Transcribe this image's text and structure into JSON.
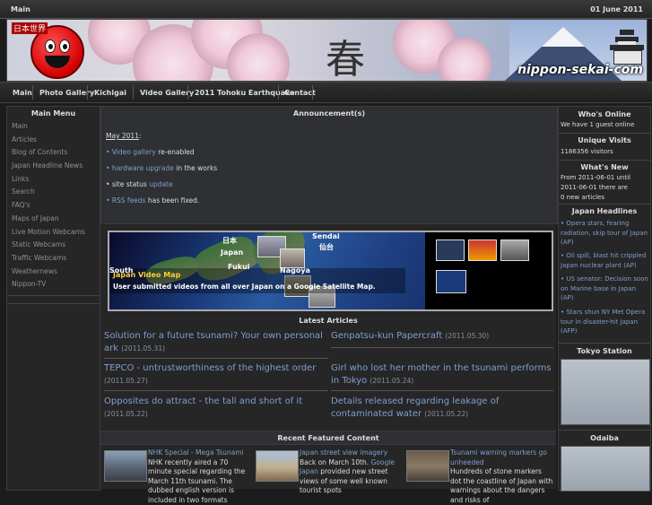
{
  "topbar": {
    "left": "Main",
    "right": "01 June 2011"
  },
  "banner": {
    "logo_text": "日本世界",
    "kanji": "春",
    "site": "nippon-sekai-com"
  },
  "nav": [
    "Main",
    "Photo Gallery",
    "Kichigai",
    "Video Gallery",
    "2011 Tohoku Earthquake",
    "Contact"
  ],
  "left_menu": {
    "title": "Main Menu",
    "items": [
      "Main",
      "Articles",
      "Blog of Contents",
      "Japan Headline News",
      "Links",
      "Search",
      "FAQ's",
      "Maps of Japan",
      "Live Motion Webcams",
      "Static Webcams",
      "Traffic Webcams",
      "Weathernews",
      "Nippon-TV"
    ]
  },
  "announcement": {
    "title": "Announcement(s)",
    "heading": "May 2011",
    "heading_colon": ":",
    "bullet1_link": "Video gallery",
    "bullet1_text": " re-enabled",
    "bullet2_link": "hardware upgrade",
    "bullet2_text": " in the works",
    "bullet3_text": "site status ",
    "bullet3_link": "update",
    "bullet4_link": "RSS feeds",
    "bullet4_text": " has been fixed."
  },
  "map": {
    "title": "Japan Video Map",
    "subtitle": "User submitted videos from all over Japan on a Google Satellite Map.",
    "labels": [
      "日本",
      "Japan",
      "Sendai",
      "仙台",
      "Fukui",
      "South",
      "Nagoya"
    ]
  },
  "latest": {
    "title": "Latest Articles",
    "items": [
      {
        "title": "Solution for a future tsunami? Your own personal ark",
        "date": "(2011.05.31)"
      },
      {
        "title": "Genpatsu-kun Papercraft",
        "date": "(2011.05.30)"
      },
      {
        "title": "TEPCO - untrustworthiness of the highest order",
        "date": "(2011.05.27)"
      },
      {
        "title": "Girl who lost her mother in the tsunami performs in Tokyo",
        "date": "(2011.05.24)"
      },
      {
        "title": "Opposites do attract - the tall and short of it",
        "date": "(2011.05.22)"
      },
      {
        "title": "Details released regarding leakage of contaminated water",
        "date": "(2011.05.22)"
      }
    ]
  },
  "featured": {
    "title": "Recent Featured Content",
    "items": [
      {
        "title": "NHK Special - Mega Tsunami",
        "text": "NHK recently aired a 70 minute special regarding the March 11th tsunami. The dubbed english version is included in two formats"
      },
      {
        "title": "Japan street view imagery",
        "text_a": "Back on March 10th. ",
        "link": "Google Japan",
        "text_b": " provided new street views of some well known tourist spots"
      },
      {
        "title": "Tsunami warning markers go unheeded",
        "text": "Hundreds of stone markers dot the coastline of Japan with warnings about the dangers and risks of"
      }
    ]
  },
  "right": {
    "whos_online_title": "Who's Online",
    "whos_online_text": "We have 1 guest online",
    "unique_title": "Unique Visits",
    "unique_text": "1186356 visitors",
    "new_title": "What's New",
    "new_text1": "From 2011-06-01 until 2011-06-01 there are",
    "new_text2": "0 new articles",
    "headlines_title": "Japan Headlines",
    "headlines": [
      "Opera stars, fearing radiation, skip tour of Japan (AP)",
      "Oil spill, blast hit crippled Japan nuclear plant (AP)",
      "US senator: Decision soon on Marine base in Japan (AP)",
      "Stars shun NY Met Opera tour in disaster-hit Japan (AFP)"
    ],
    "cam1_title": "Tokyo Station",
    "cam2_title": "Odaiba"
  },
  "colors": {
    "link": "#7f9fcf",
    "background": "#1c1c1c",
    "panel": "#262626"
  }
}
